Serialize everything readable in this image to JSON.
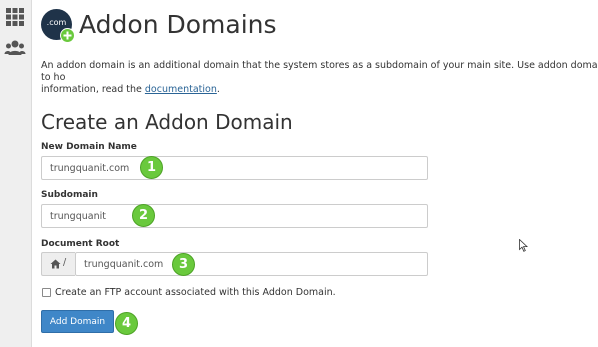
{
  "sidebar": {
    "items": [
      {
        "icon": "grid-icon",
        "label": ""
      },
      {
        "icon": "users-icon",
        "label": ""
      }
    ]
  },
  "header": {
    "logo_text": ".com",
    "title": "Addon Domains"
  },
  "intro": {
    "text": "An addon domain is an additional domain that the system stores as a subdomain of your main site. Use addon domains to ho",
    "text2": "information, read the ",
    "link": "documentation",
    "after_link": "."
  },
  "form": {
    "heading": "Create an Addon Domain",
    "new_domain": {
      "label": "New Domain Name",
      "value": "trungquanit.com",
      "step": "1"
    },
    "subdomain": {
      "label": "Subdomain",
      "value": "trungquanit",
      "step": "2"
    },
    "document_root": {
      "label": "Document Root",
      "prefix": "/",
      "value": "trungquanit.com",
      "step": "3"
    },
    "ftp_checkbox": {
      "label": "Create an FTP account associated with this Addon Domain.",
      "checked": false
    },
    "submit": {
      "label": "Add Domain",
      "step": "4"
    }
  },
  "colors": {
    "accent": "#3f87c8",
    "step_badge": "#6ac93d",
    "link": "#2a6496"
  }
}
